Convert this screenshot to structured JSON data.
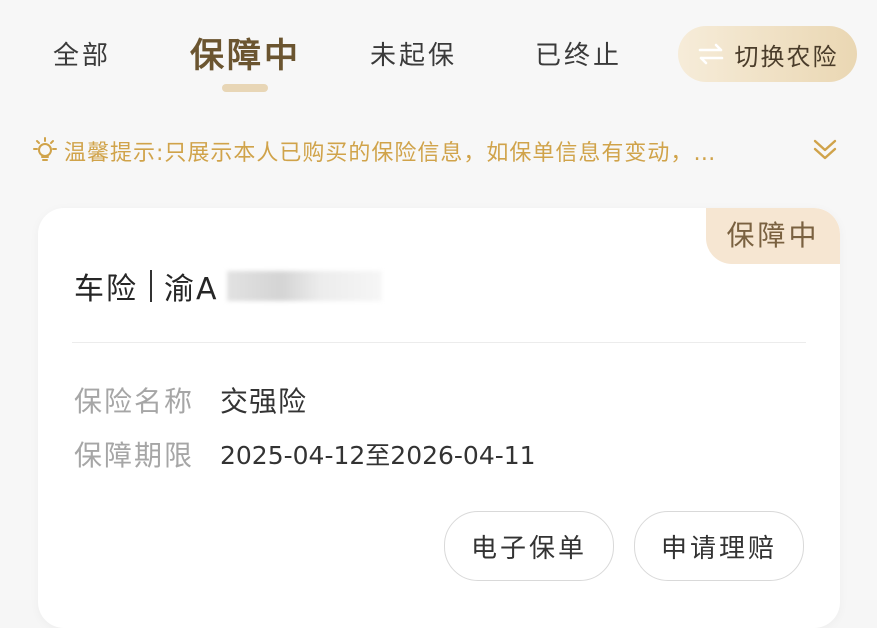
{
  "tabs": [
    {
      "label": "全部"
    },
    {
      "label": "保障中"
    },
    {
      "label": "未起保"
    },
    {
      "label": "已终止"
    }
  ],
  "switch_button": {
    "label": "切换农险",
    "icon": "swap-arrows-icon"
  },
  "notice": {
    "icon": "lightbulb-icon",
    "text": "温馨提示:只展示本人已购买的保险信息，如保单信息有变动，…",
    "expand_icon": "double-chevron-down-icon"
  },
  "card": {
    "status": "保障中",
    "type": "车险",
    "plate_prefix": "渝A",
    "fields": [
      {
        "label": "保险名称",
        "value": "交强险"
      },
      {
        "label": "保障期限",
        "value": "2025-04-12至2026-04-11"
      }
    ],
    "actions": [
      {
        "label": "电子保单"
      },
      {
        "label": "申请理赔"
      }
    ]
  },
  "colors": {
    "accent_gold": "#d0a34a",
    "active_tab": "#6b5530",
    "badge_bg": "#f6e6d2",
    "switch_gradient_start": "#f6ecd9",
    "switch_gradient_end": "#ead7b3"
  }
}
